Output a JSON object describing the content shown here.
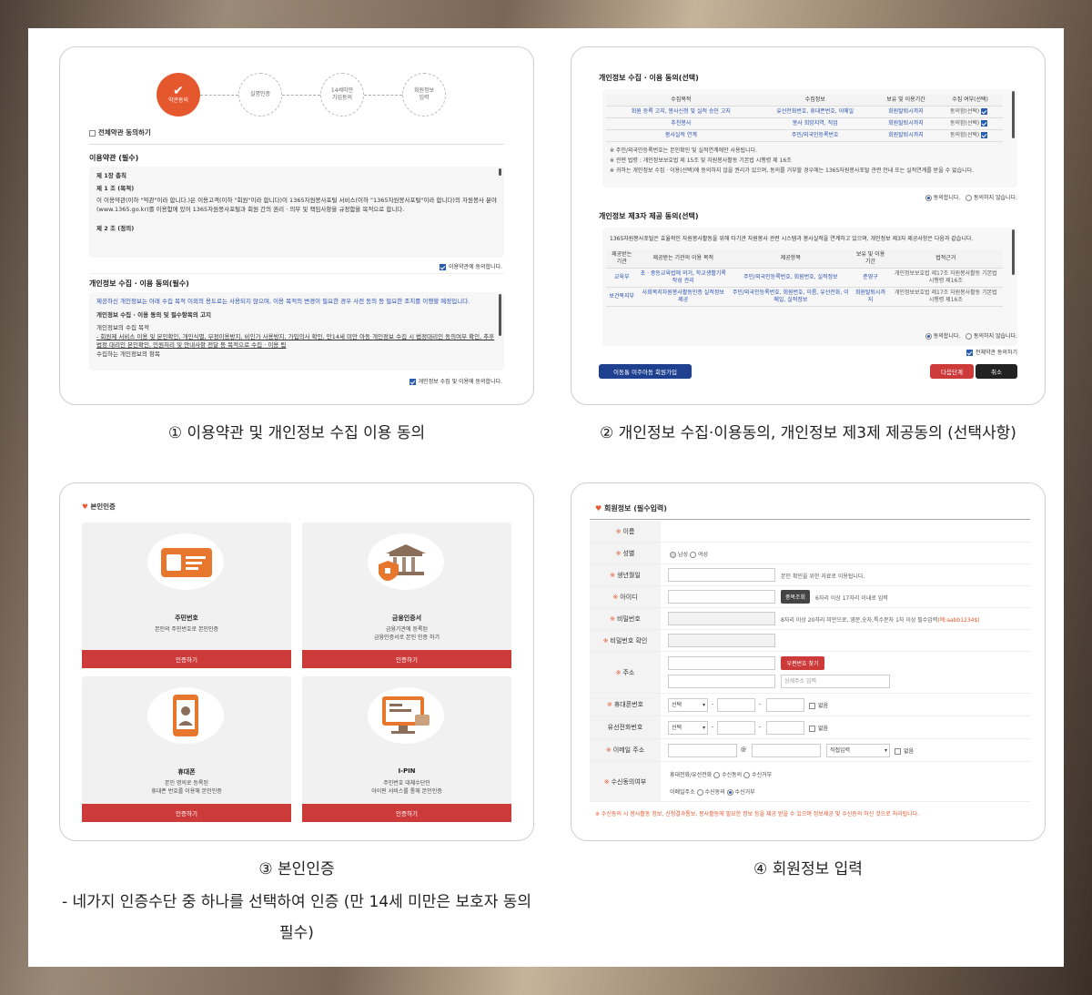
{
  "panel1": {
    "steps": [
      "약관동의",
      "실명인증",
      "14세미만\n가입동의",
      "회원정보\n입력"
    ],
    "agree_all": "전체약관 동의하기",
    "terms_title": "이용약관 (필수)",
    "terms_lines": [
      "제 1장 총칙",
      "제 1 조 (목적)",
      "이 이용약관(이하 \"약관\"이라 합니다.)은 이용고객(이하 \"회원\"이라 합니다)이 1365자원봉사포털 서비스(이하 \"1365자원봉사포털\"이라 합니다)의 자원봉사 분야(www.1365.go.kr)를 이용함에 있어 1365자원봉사포털과 회원 간의 권리 · 의무 및 책임사항을 규정함을 목적으로 합니다.",
      "제 2 조 (정의)"
    ],
    "terms_agree": "이용약관에 동의합니다.",
    "privacy_title": "개인정보 수집 · 이용 동의(필수)",
    "privacy_lines": [
      "제공하신 개인정보는 아래 수집 목적 이외의 용도로는 사용되지 않으며, 이용 목적의 변경이 필요한 경우 사전 동의 등 필요한 조치를 이행할 예정입니다.",
      "개인정보 수집 · 이용 동의 및 필수항목의 고지",
      "개인정보의 수집 목적",
      "- 회원제 서비스 이용 및 본인확인, 개인식별, 부정이용방지, 비인가 사용방지, 가입의사 확인, 만14세 미만 아동 개인정보 수집 시 법정대리인 동의여부 확인, 추후 법정 대리인 본인확인, 민원처리 및 안내사항 전달 등 목적으로 수집 · 이용 됨",
      "수집하는 개인정보의 항목"
    ],
    "privacy_agree": "개인정보 수집 및 이용에 동의합니다."
  },
  "panel2": {
    "sec1_title": "개인정보 수집 · 이용 동의(선택)",
    "table1_headers": [
      "수집목적",
      "수집정보",
      "보유 및 이용기간",
      "수집 여부(선택)"
    ],
    "table1_rows": [
      [
        "회원 등록 고지, 봉사신청 및 실적 승인 고지",
        "유선전화번호, 휴대폰번호, 이메일",
        "회원탈퇴시까지",
        "동의함(선택)"
      ],
      [
        "추천봉사",
        "봉사 희망지역, 직업",
        "회원탈퇴시까지",
        "동의함(선택)"
      ],
      [
        "봉사실적 연계",
        "주민/외국인등록번호",
        "회원탈퇴시까지",
        "동의함(선택)"
      ]
    ],
    "notes": [
      "※ 주민/외국인등록번호는 본인확인 및 실적연계에만 사용됩니다.",
      "※ 관련 법령 : 개인정보보호법 제 15조 및 자원봉사활동 기본법 시행령 제 16조",
      "※ 귀하는 개인정보 수집 · 이용(선택)에 동의하지 않을 권리가 있으며, 동의를 거부할 경우에는 1365자원봉사포털 관련 안내 또는 실적연계를 받을 수 없습니다."
    ],
    "agree": "동의합니다.",
    "disagree": "동의하지 않습니다.",
    "sec2_title": "개인정보 제3자 제공 동의(선택)",
    "sec2_intro": "1365자원봉사포털은 효율적인 자원봉사활동을 위해 타기관 자원봉사 관련 시스템과 봉사실적을 연계하고 있으며, 개인정보 제3자 제공사항은 다음과 같습니다.",
    "table2_headers": [
      "제공받는 기관",
      "제공받는 기관의 이용 목적",
      "제공항목",
      "보유 및 이용기간",
      "법적근거"
    ],
    "table2_rows": [
      [
        "교육부",
        "초 · 중등교육법에 의거, 학교생활기록 작성 관리",
        "주민/외국인등록번호, 회원번호, 실적정보",
        "준영구",
        "개인정보보호법 제17조 자원봉사활동 기본법 시행령 제16조"
      ],
      [
        "보건복지부",
        "사회복지자원봉사활동인증 실적정보 제공",
        "주민/외국인등록번호, 회원번호, 이름, 유선전화, 이메일, 실적정보",
        "회원탈퇴시까지",
        "개인정보보호법 제17조 자원봉사활동 기본법 시행령 제16조"
      ]
    ],
    "agree_all_terms": "전체약관 동의하기",
    "kid_btn": "이동통 이주아동 회원가입",
    "next_btn": "다음단계",
    "cancel_btn": "취소"
  },
  "panel3": {
    "title": "본인인증",
    "cards": [
      {
        "title": "주민번호",
        "desc": "본인의 주민번호로 본인인증",
        "button": "인증하기"
      },
      {
        "title": "금융인증서",
        "desc": "금융기관에 등록된\n금융인증서로 본인 인증 하기",
        "button": "인증하기"
      },
      {
        "title": "휴대폰",
        "desc": "본인 명의로 등록된\n휴대폰 번호를 이용해 본인인증",
        "button": "인증하기"
      },
      {
        "title": "I-PIN",
        "desc": "주민번호 대체수단인\n아이핀 서비스를 통해 본인인증",
        "button": "인증하기"
      }
    ]
  },
  "panel4": {
    "title": "회원정보 (필수입력)",
    "labels": {
      "name": "이름",
      "gender": "성별",
      "birth": "생년월일",
      "id": "아이디",
      "password": "비밀번호",
      "password_confirm": "비밀번호 확인",
      "address": "주소",
      "mobile": "휴대폰번호",
      "phone": "유선전화번호",
      "email": "이메일 주소",
      "consent": "수신동의여부"
    },
    "male": "남성",
    "female": "여성",
    "birth_note": "본인 확인을 위한 자료로 이용됩니다.",
    "dup_btn": "중복조회",
    "id_note": "6자리 이상 17자리 이내로 입력",
    "pw_note": "8자리 이상 20자리 미만으로, 영문,숫자,특수문자 1자 이상 필수입력",
    "pw_example": "(예:aabb1234$)",
    "zip_btn": "우편번호 찾기",
    "addr_placeholder": "상세주소 입력",
    "select": "선택",
    "none": "없음",
    "at": "@",
    "email_select": "직접입력",
    "sms_label": "휴대전화/유선전화",
    "email_label": "이메일주소",
    "opt_in": "수신동의",
    "opt_out": "수신거부",
    "footer_note": "※ 수신동의 시 봉사활동 정보, 신청결과통보, 봉사활동에 필요한 정보 등을 제공 받을 수 있으며 정보제공 및 수신동의 하신 것으로 처리됩니다."
  },
  "captions": {
    "c1": "① 이용약관 및 개인정보 수집 이용 동의",
    "c2": "② 개인정보 수집·이용동의, 개인정보 제3제 제공동의 (선택사항)",
    "c3": "③ 본인인증",
    "c4": "④ 회원정보 입력",
    "note": "- 네가지 인증수단 중 하나를 선택하여 인증 (만 14세 미만은 보호자 동의 필수)"
  },
  "colors": {
    "accent": "#e5572d",
    "red_button": "#cc3a3a",
    "navy_button": "#1f3f8f",
    "link_blue": "#2a4fb4"
  }
}
